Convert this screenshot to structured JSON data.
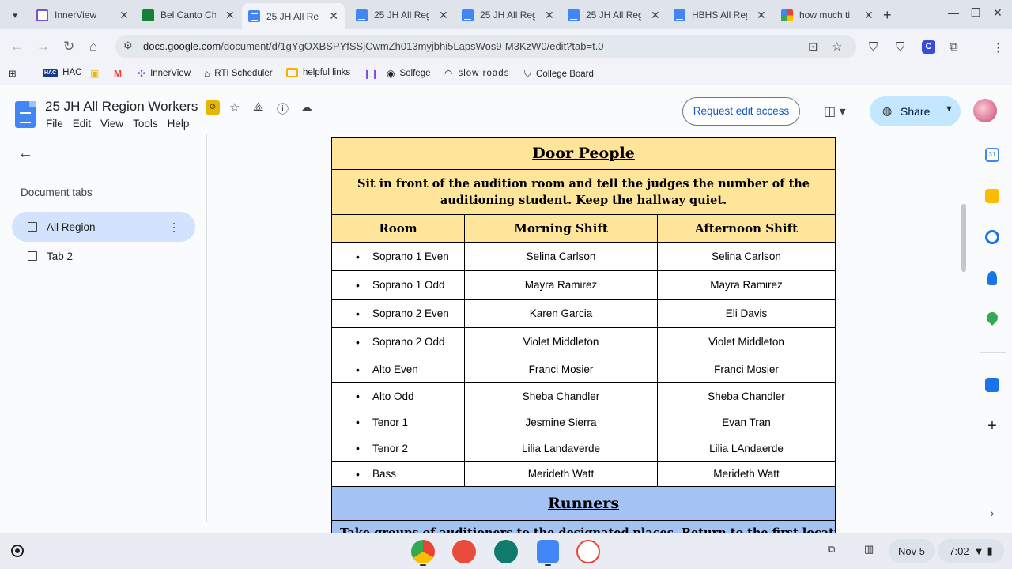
{
  "browser": {
    "tabs": [
      {
        "title": "InnerView",
        "favicon": "innerview-icon",
        "active": false
      },
      {
        "title": "Bel Canto Ch",
        "favicon": "sheets-icon",
        "active": false
      },
      {
        "title": "25 JH All Reg",
        "favicon": "docs-icon",
        "active": true
      },
      {
        "title": "25 JH All Reg",
        "favicon": "docs-icon",
        "active": false
      },
      {
        "title": "25 JH All Reg",
        "favicon": "docs-icon",
        "active": false
      },
      {
        "title": "25 JH All Reg",
        "favicon": "docs-icon",
        "active": false
      },
      {
        "title": "HBHS All Reg",
        "favicon": "docs-icon",
        "active": false
      },
      {
        "title": "how much ti",
        "favicon": "google-icon",
        "active": false
      }
    ],
    "url_host": "docs.google.com",
    "url_path": "/document/d/1gYgOXBSPYfSSjCwmZh013myjbhi5LapsWos9-M3KzW0/edit?tab=t.0",
    "bookmarks": [
      "HAC",
      "",
      "",
      "InnerView",
      "RTI Scheduler",
      "helpful links",
      "",
      "Solfege",
      "slow roads",
      "College Board"
    ]
  },
  "docs": {
    "title": "25 JH All Region Workers",
    "menu": [
      "File",
      "Edit",
      "View",
      "Tools",
      "Help"
    ],
    "request_edit": "Request edit access",
    "share": "Share"
  },
  "sidebar": {
    "heading": "Document tabs",
    "tabs": [
      {
        "label": "All Region",
        "active": true
      },
      {
        "label": "Tab 2",
        "active": false
      }
    ]
  },
  "document": {
    "door_people": {
      "title": "Door People",
      "description": "Sit in front of the audition room and tell the judges the number of the auditioning student. Keep the hallway quiet.",
      "columns": [
        "Room",
        "Morning Shift",
        "Afternoon Shift"
      ],
      "rows": [
        {
          "room": "Soprano 1 Even",
          "morning": "Selina Carlson",
          "afternoon": "Selina Carlson"
        },
        {
          "room": "Soprano 1 Odd",
          "morning": "Mayra Ramirez",
          "afternoon": "Mayra Ramirez"
        },
        {
          "room": "Soprano 2 Even",
          "morning": "Karen Garcia",
          "afternoon": "Eli Davis"
        },
        {
          "room": "Soprano 2 Odd",
          "morning": "Violet Middleton",
          "afternoon": "Violet Middleton"
        },
        {
          "room": "Alto Even",
          "morning": "Franci Mosier",
          "afternoon": "Franci Mosier"
        },
        {
          "room": "Alto Odd",
          "morning": "Sheba Chandler",
          "afternoon": "Sheba Chandler"
        },
        {
          "room": "Tenor 1",
          "morning": "Jesmine Sierra",
          "afternoon": "Evan Tran"
        },
        {
          "room": "Tenor 2",
          "morning": "Lilia Landaverde",
          "afternoon": "Lilia LAndaerde"
        },
        {
          "room": "Bass",
          "morning": "Merideth Watt",
          "afternoon": "Merideth Watt"
        }
      ]
    },
    "runners": {
      "title": "Runners",
      "description": "Take groups of auditioners to the designated places. Return to the first location"
    }
  },
  "shelf": {
    "date": "Nov 5",
    "time": "7:02"
  },
  "colors": {
    "yellow_header": "#ffe599",
    "blue_header": "#a4c2f4",
    "share_bg": "#c2e7ff",
    "active_tab_bg": "#d3e3fd"
  }
}
